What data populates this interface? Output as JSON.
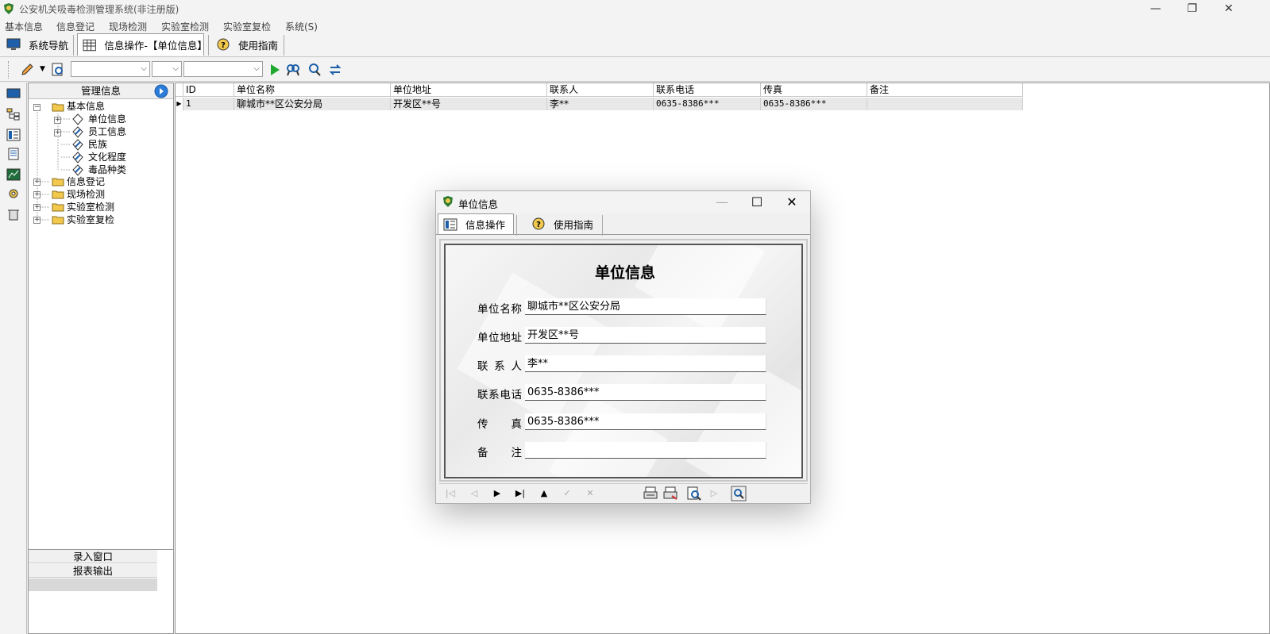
{
  "window": {
    "title": "公安机关吸毒检测管理系统(非注册版)",
    "minimize": "—",
    "restore": "❐",
    "close": "✕"
  },
  "menu": [
    "基本信息",
    "信息登记",
    "现场检测",
    "实验室检测",
    "实验室复检",
    "系统(S)"
  ],
  "tabs": [
    {
      "label": "系统导航",
      "icon": "monitor-icon"
    },
    {
      "label": "信息操作-【单位信息】",
      "icon": "grid-icon"
    },
    {
      "label": "使用指南",
      "icon": "help-icon"
    }
  ],
  "tree": {
    "header": "管理信息",
    "nodes": [
      {
        "label": "基本信息",
        "level": 0,
        "expanded": true
      },
      {
        "label": "单位信息",
        "level": 1
      },
      {
        "label": "员工信息",
        "level": 1
      },
      {
        "label": "民族",
        "level": 1
      },
      {
        "label": "文化程度",
        "level": 1
      },
      {
        "label": "毒品种类",
        "level": 1
      },
      {
        "label": "信息登记",
        "level": 0
      },
      {
        "label": "现场检测",
        "level": 0
      },
      {
        "label": "实验室检测",
        "level": 0
      },
      {
        "label": "实验室复检",
        "level": 0
      }
    ],
    "bottom_buttons": [
      "录入窗口",
      "报表输出"
    ]
  },
  "grid": {
    "columns": [
      "ID",
      "单位名称",
      "单位地址",
      "联系人",
      "联系电话",
      "传真",
      "备注"
    ],
    "rows": [
      [
        "1",
        "聊城市**区公安分局",
        "开发区**号",
        "李**",
        "0635-8386***",
        "0635-8386***",
        ""
      ]
    ]
  },
  "dialog": {
    "title": "单位信息",
    "minimize": "—",
    "maximize": "☐",
    "close": "✕",
    "tabs": [
      "信息操作",
      "使用指南"
    ],
    "form_title": "单位信息",
    "fields": [
      {
        "label": "单位名称",
        "value": "聊城市**区公安分局"
      },
      {
        "label": "单位地址",
        "value": "开发区**号"
      },
      {
        "label": "联系人",
        "value": "李**"
      },
      {
        "label": "联系电话",
        "value": "0635-8386***"
      },
      {
        "label": "传真",
        "value": "0635-8386***"
      },
      {
        "label": "备注",
        "value": ""
      }
    ],
    "nav": {
      "first": "|◁",
      "prior": "◁",
      "next": "▶",
      "last": "▶|",
      "insert": "▲",
      "post": "✓",
      "cancel": "✕",
      "play": "▷"
    }
  },
  "colors": {
    "accent": "#2b7bd8",
    "folder": "#f2c94c",
    "selected_row": "#e8e8e8"
  }
}
